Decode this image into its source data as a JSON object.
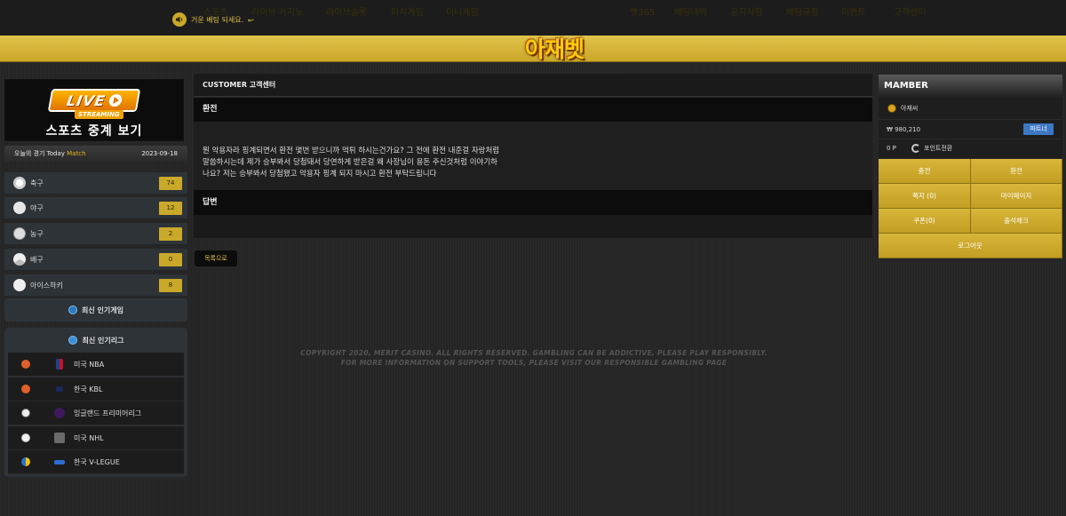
{
  "notice": {
    "text": "거운 배팅 되세요."
  },
  "nav": {
    "left": [
      "스포츠",
      "라이브 카지노",
      "라이브슬롯",
      "터치게임",
      "미니게임"
    ],
    "logo": "아재벳",
    "right": [
      "벳365",
      "베팅내역",
      "공지사항",
      "배팅규정",
      "이벤트",
      "고객센터"
    ]
  },
  "live": {
    "badge": "LIVE",
    "sub": "STREAMING",
    "title": "스포츠 중계 보기"
  },
  "today": {
    "label_prefix": "오늘의 경기 Today",
    "label_match": "Match",
    "date": "2023-09-18"
  },
  "sports": [
    {
      "label": "축구",
      "count": "74",
      "icon": "soccer-icon"
    },
    {
      "label": "야구",
      "count": "12",
      "icon": "baseball-icon"
    },
    {
      "label": "농구",
      "count": "2",
      "icon": "basketball-icon"
    },
    {
      "label": "배구",
      "count": "0",
      "icon": "volleyball-icon"
    },
    {
      "label": "아이스하키",
      "count": "8",
      "icon": "hockey-icon"
    }
  ],
  "popular_games": {
    "label": "최신 인기게임"
  },
  "popular_leagues": {
    "title": "최신 인기리그",
    "items": [
      {
        "name": "미국 NBA",
        "ball": "basketball"
      },
      {
        "name": "한국 KBL",
        "ball": "basketball"
      },
      {
        "name": "잉글랜드 프리미어리그",
        "ball": "soccer"
      },
      {
        "name": "미국 NHL",
        "ball": "baseball"
      },
      {
        "name": "한국 V-LEGUE",
        "ball": "volleyball"
      }
    ]
  },
  "main": {
    "header": "CUSTOMER 고객센터",
    "subject": "환전",
    "body": [
      "뭔 악용자라 핑계되면서 환전 몇번 받으니까 먹튀 하시는건가요? 그 전에 환전 내준걸 자랑처럼",
      "말씀하시는데 제가 승부봐서 당첨돼서 당연하게 받은걸 왜 사장님이 용돈 주신것처럼 이야기하",
      "나요? 저는 승부봐서 당첨됐고 악용자 핑계 되지 마시고 환전 부탁드립니다"
    ],
    "answer_header": "답변",
    "answer_body": "",
    "list_button": "목록으로"
  },
  "copyright": [
    "COPYRIGHT 2020, MERIT CASINO. ALL RIGHTS RESERVED. GAMBLING CAN BE ADDICTIVE, PLEASE PLAY RESPONSIBLY.",
    "FOR MORE INFORMATION ON SUPPORT TOOLS, PLEASE VISIT OUR RESPONSIBLE GAMBLING PAGE"
  ],
  "member": {
    "header": "MAMBER",
    "username": "아재씨",
    "money": "₩ 980,210",
    "partner": "파트너",
    "points": "0 P",
    "point_convert": "포인트전환",
    "buttons": [
      "충전",
      "환전",
      "쪽지 (0)",
      "마이페이지",
      "쿠폰(0)",
      "출석체크"
    ],
    "logout": "로그아웃"
  },
  "colors": {
    "gold": "#c9a82a",
    "nav_gold": "#e2c44a",
    "blue": "#3d78c5"
  }
}
